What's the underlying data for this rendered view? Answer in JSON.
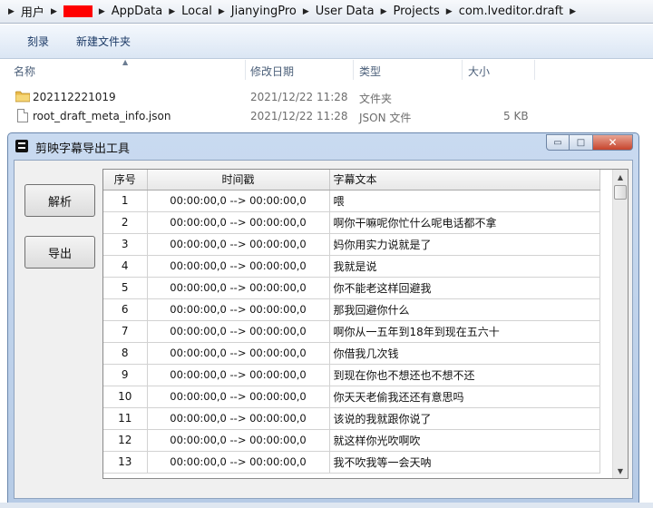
{
  "breadcrumb": {
    "items": [
      "用户",
      "AppData",
      "Local",
      "JianyingPro",
      "User Data",
      "Projects",
      "com.lveditor.draft"
    ]
  },
  "toolbar": {
    "burn_label": "刻录",
    "new_folder_label": "新建文件夹"
  },
  "columns": {
    "name": "名称",
    "modified": "修改日期",
    "type": "类型",
    "size": "大小"
  },
  "files": [
    {
      "name": "202112221019",
      "modified": "2021/12/22 11:28",
      "type": "文件夹",
      "size": "",
      "icon": "folder-icon"
    },
    {
      "name": "root_draft_meta_info.json",
      "modified": "2021/12/22 11:28",
      "type": "JSON 文件",
      "size": "5 KB",
      "icon": "file-icon"
    }
  ],
  "window": {
    "title": "剪映字幕导出工具",
    "buttons": {
      "parse": "解析",
      "export": "导出"
    },
    "controls": {
      "minimize": "▭",
      "maximize": "□",
      "close": "✕"
    }
  },
  "table": {
    "headers": [
      "序号",
      "时间戳",
      "字幕文本"
    ],
    "rows": [
      [
        "1",
        "00:00:00,0 --> 00:00:00,0",
        "喂"
      ],
      [
        "2",
        "00:00:00,0 --> 00:00:00,0",
        "啊你干嘛呢你忙什么呢电话都不拿"
      ],
      [
        "3",
        "00:00:00,0 --> 00:00:00,0",
        "妈你用实力说就是了"
      ],
      [
        "4",
        "00:00:00,0 --> 00:00:00,0",
        "我就是说"
      ],
      [
        "5",
        "00:00:00,0 --> 00:00:00,0",
        "你不能老这样回避我"
      ],
      [
        "6",
        "00:00:00,0 --> 00:00:00,0",
        "那我回避你什么"
      ],
      [
        "7",
        "00:00:00,0 --> 00:00:00,0",
        "啊你从一五年到18年到现在五六十"
      ],
      [
        "8",
        "00:00:00,0 --> 00:00:00,0",
        "你借我几次钱"
      ],
      [
        "9",
        "00:00:00,0 --> 00:00:00,0",
        "到现在你也不想还也不想不还"
      ],
      [
        "10",
        "00:00:00,0 --> 00:00:00,0",
        "你天天老偷我还还有意思吗"
      ],
      [
        "11",
        "00:00:00,0 --> 00:00:00,0",
        "该说的我就跟你说了"
      ],
      [
        "12",
        "00:00:00,0 --> 00:00:00,0",
        "就这样你光吹啊吹"
      ],
      [
        "13",
        "00:00:00,0 --> 00:00:00,0",
        "我不吹我等一会天呐"
      ]
    ]
  },
  "colors": {
    "window_frame": "#b6cbe6",
    "close_button": "#c7442c",
    "redaction": "#ff0000"
  }
}
